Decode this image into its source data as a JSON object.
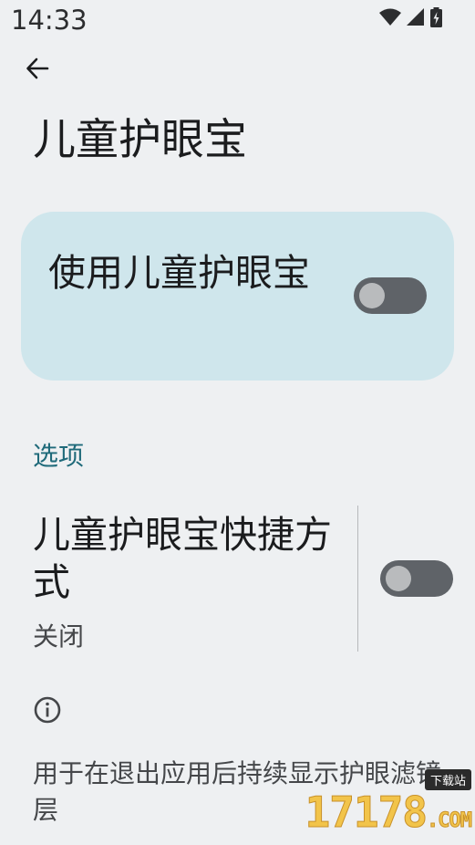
{
  "status_bar": {
    "time": "14:33",
    "icons": [
      "wifi-icon",
      "signal-icon",
      "battery-charging-icon"
    ]
  },
  "header": {
    "back_icon": "arrow-left-icon",
    "title": "儿童护眼宝"
  },
  "main_toggle_card": {
    "label": "使用儿童护眼宝",
    "state": "off",
    "accent": "#cfe6ec"
  },
  "options_section": {
    "header": "选项",
    "shortcut": {
      "title": "儿童护眼宝快捷方式",
      "summary": "关闭",
      "state": "off"
    }
  },
  "footer": {
    "info_icon": "info-icon",
    "text": "用于在退出应用后持续显示护眼滤镜层"
  },
  "watermark": {
    "badge": "下载站",
    "brand": "17178",
    "domain": ".COM"
  },
  "colors": {
    "background": "#eef0f2",
    "section_accent": "#1f6a7a",
    "toggle_track_off": "#5f6368"
  }
}
